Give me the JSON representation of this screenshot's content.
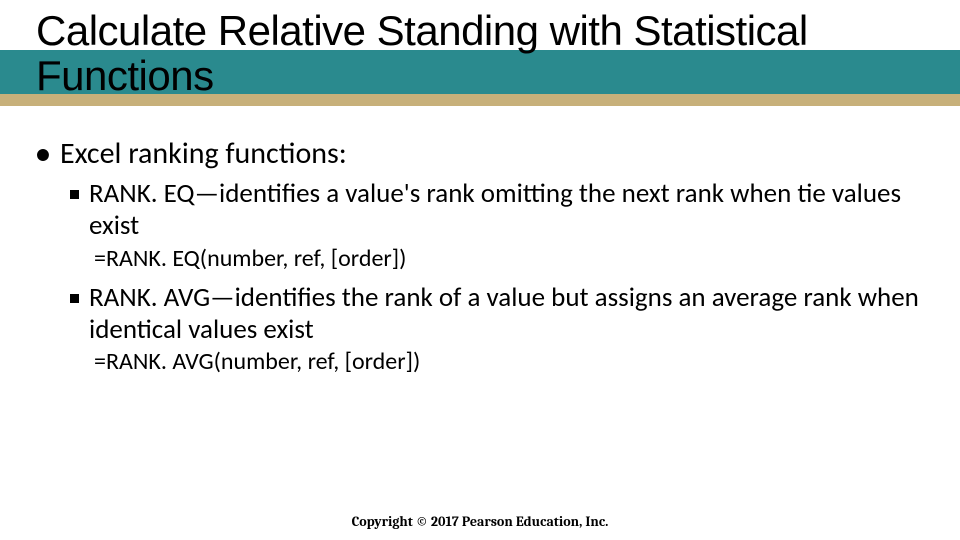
{
  "slide": {
    "title": "Calculate Relative Standing with Statistical Functions",
    "copyright": "Copyright © 2017 Pearson Education, Inc.",
    "colors": {
      "teal": "#2a8a8e",
      "tan": "#c7b07a"
    }
  },
  "content": {
    "lvl1": "Excel ranking functions:",
    "items": [
      {
        "label": "RANK. EQ—identifies a value's rank omitting the next rank when tie values exist",
        "syntax": "=RANK. EQ(number, ref, [order])"
      },
      {
        "label": "RANK. AVG—identifies the rank of a value but assigns an average rank when identical values exist",
        "syntax": "=RANK. AVG(number, ref, [order])"
      }
    ]
  }
}
